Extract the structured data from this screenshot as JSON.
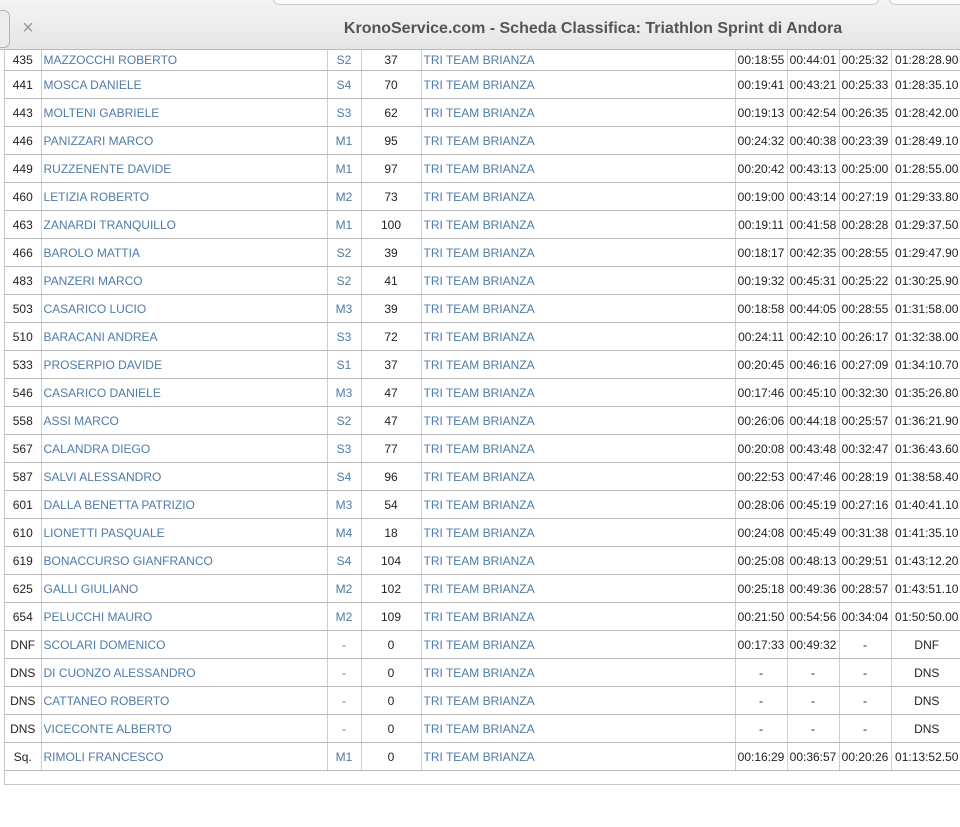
{
  "window": {
    "title": "KronoService.com - Scheda Classifica: Triathlon Sprint di Andora",
    "close_glyph": "×"
  },
  "rows": [
    {
      "pos": "435",
      "name": "MAZZOCCHI ROBERTO",
      "cat": "S2",
      "pts": "37",
      "team": "TRI TEAM BRIANZA",
      "t1": "00:18:55",
      "t2": "00:44:01",
      "t3": "00:25:32",
      "total": "01:28:28.90"
    },
    {
      "pos": "441",
      "name": "MOSCA DANIELE",
      "cat": "S4",
      "pts": "70",
      "team": "TRI TEAM BRIANZA",
      "t1": "00:19:41",
      "t2": "00:43:21",
      "t3": "00:25:33",
      "total": "01:28:35.10"
    },
    {
      "pos": "443",
      "name": "MOLTENI GABRIELE",
      "cat": "S3",
      "pts": "62",
      "team": "TRI TEAM BRIANZA",
      "t1": "00:19:13",
      "t2": "00:42:54",
      "t3": "00:26:35",
      "total": "01:28:42.00"
    },
    {
      "pos": "446",
      "name": "PANIZZARI MARCO",
      "cat": "M1",
      "pts": "95",
      "team": "TRI TEAM BRIANZA",
      "t1": "00:24:32",
      "t2": "00:40:38",
      "t3": "00:23:39",
      "total": "01:28:49.10"
    },
    {
      "pos": "449",
      "name": "RUZZENENTE DAVIDE",
      "cat": "M1",
      "pts": "97",
      "team": "TRI TEAM BRIANZA",
      "t1": "00:20:42",
      "t2": "00:43:13",
      "t3": "00:25:00",
      "total": "01:28:55.00"
    },
    {
      "pos": "460",
      "name": "LETIZIA ROBERTO",
      "cat": "M2",
      "pts": "73",
      "team": "TRI TEAM BRIANZA",
      "t1": "00:19:00",
      "t2": "00:43:14",
      "t3": "00:27:19",
      "total": "01:29:33.80"
    },
    {
      "pos": "463",
      "name": "ZANARDI TRANQUILLO",
      "cat": "M1",
      "pts": "100",
      "team": "TRI TEAM BRIANZA",
      "t1": "00:19:11",
      "t2": "00:41:58",
      "t3": "00:28:28",
      "total": "01:29:37.50"
    },
    {
      "pos": "466",
      "name": "BAROLO MATTIA",
      "cat": "S2",
      "pts": "39",
      "team": "TRI TEAM BRIANZA",
      "t1": "00:18:17",
      "t2": "00:42:35",
      "t3": "00:28:55",
      "total": "01:29:47.90"
    },
    {
      "pos": "483",
      "name": "PANZERI MARCO",
      "cat": "S2",
      "pts": "41",
      "team": "TRI TEAM BRIANZA",
      "t1": "00:19:32",
      "t2": "00:45:31",
      "t3": "00:25:22",
      "total": "01:30:25.90"
    },
    {
      "pos": "503",
      "name": "CASARICO LUCIO",
      "cat": "M3",
      "pts": "39",
      "team": "TRI TEAM BRIANZA",
      "t1": "00:18:58",
      "t2": "00:44:05",
      "t3": "00:28:55",
      "total": "01:31:58.00"
    },
    {
      "pos": "510",
      "name": "BARACANI ANDREA",
      "cat": "S3",
      "pts": "72",
      "team": "TRI TEAM BRIANZA",
      "t1": "00:24:11",
      "t2": "00:42:10",
      "t3": "00:26:17",
      "total": "01:32:38.00"
    },
    {
      "pos": "533",
      "name": "PROSERPIO DAVIDE",
      "cat": "S1",
      "pts": "37",
      "team": "TRI TEAM BRIANZA",
      "t1": "00:20:45",
      "t2": "00:46:16",
      "t3": "00:27:09",
      "total": "01:34:10.70"
    },
    {
      "pos": "546",
      "name": "CASARICO DANIELE",
      "cat": "M3",
      "pts": "47",
      "team": "TRI TEAM BRIANZA",
      "t1": "00:17:46",
      "t2": "00:45:10",
      "t3": "00:32:30",
      "total": "01:35:26.80"
    },
    {
      "pos": "558",
      "name": "ASSI MARCO",
      "cat": "S2",
      "pts": "47",
      "team": "TRI TEAM BRIANZA",
      "t1": "00:26:06",
      "t2": "00:44:18",
      "t3": "00:25:57",
      "total": "01:36:21.90"
    },
    {
      "pos": "567",
      "name": "CALANDRA DIEGO",
      "cat": "S3",
      "pts": "77",
      "team": "TRI TEAM BRIANZA",
      "t1": "00:20:08",
      "t2": "00:43:48",
      "t3": "00:32:47",
      "total": "01:36:43.60"
    },
    {
      "pos": "587",
      "name": "SALVI ALESSANDRO",
      "cat": "S4",
      "pts": "96",
      "team": "TRI TEAM BRIANZA",
      "t1": "00:22:53",
      "t2": "00:47:46",
      "t3": "00:28:19",
      "total": "01:38:58.40"
    },
    {
      "pos": "601",
      "name": "DALLA BENETTA PATRIZIO",
      "cat": "M3",
      "pts": "54",
      "team": "TRI TEAM BRIANZA",
      "t1": "00:28:06",
      "t2": "00:45:19",
      "t3": "00:27:16",
      "total": "01:40:41.10"
    },
    {
      "pos": "610",
      "name": "LIONETTI PASQUALE",
      "cat": "M4",
      "pts": "18",
      "team": "TRI TEAM BRIANZA",
      "t1": "00:24:08",
      "t2": "00:45:49",
      "t3": "00:31:38",
      "total": "01:41:35.10"
    },
    {
      "pos": "619",
      "name": "BONACCURSO GIANFRANCO",
      "cat": "S4",
      "pts": "104",
      "team": "TRI TEAM BRIANZA",
      "t1": "00:25:08",
      "t2": "00:48:13",
      "t3": "00:29:51",
      "total": "01:43:12.20"
    },
    {
      "pos": "625",
      "name": "GALLI GIULIANO",
      "cat": "M2",
      "pts": "102",
      "team": "TRI TEAM BRIANZA",
      "t1": "00:25:18",
      "t2": "00:49:36",
      "t3": "00:28:57",
      "total": "01:43:51.10"
    },
    {
      "pos": "654",
      "name": "PELUCCHI MAURO",
      "cat": "M2",
      "pts": "109",
      "team": "TRI TEAM BRIANZA",
      "t1": "00:21:50",
      "t2": "00:54:56",
      "t3": "00:34:04",
      "total": "01:50:50.00"
    },
    {
      "pos": "DNF",
      "name": "SCOLARI DOMENICO",
      "cat": "-",
      "pts": "0",
      "team": "TRI TEAM BRIANZA",
      "t1": "00:17:33",
      "t2": "00:49:32",
      "t3": "-",
      "total": "DNF"
    },
    {
      "pos": "DNS",
      "name": "DI CUONZO ALESSANDRO",
      "cat": "-",
      "pts": "0",
      "team": "TRI TEAM BRIANZA",
      "t1": "-",
      "t2": "-",
      "t3": "-",
      "total": "DNS"
    },
    {
      "pos": "DNS",
      "name": "CATTANEO ROBERTO",
      "cat": "-",
      "pts": "0",
      "team": "TRI TEAM BRIANZA",
      "t1": "-",
      "t2": "-",
      "t3": "-",
      "total": "DNS"
    },
    {
      "pos": "DNS",
      "name": "VICECONTE ALBERTO",
      "cat": "-",
      "pts": "0",
      "team": "TRI TEAM BRIANZA",
      "t1": "-",
      "t2": "-",
      "t3": "-",
      "total": "DNS"
    },
    {
      "pos": "Sq.",
      "name": "RIMOLI FRANCESCO",
      "cat": "M1",
      "pts": "0",
      "team": "TRI TEAM BRIANZA",
      "t1": "00:16:29",
      "t2": "00:36:57",
      "t3": "00:20:26",
      "total": "01:13:52.50"
    }
  ]
}
